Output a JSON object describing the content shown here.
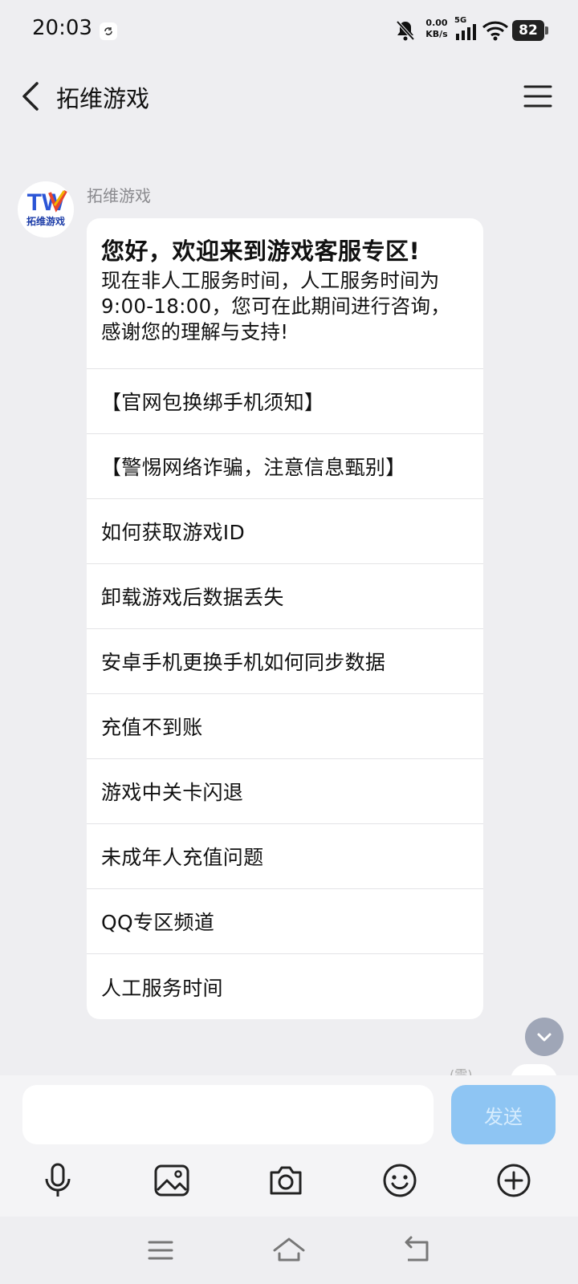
{
  "status_bar": {
    "time": "20:03",
    "net_speed_value": "0.00",
    "net_speed_unit": "KB/s",
    "signal_label": "5G",
    "battery": "82"
  },
  "header": {
    "title": "拓维游戏"
  },
  "chat": {
    "sender_name": "拓维游戏",
    "avatar_logo_text": "TW",
    "avatar_sub_text": "拓维游戏",
    "message_title": "您好，欢迎来到游戏客服专区!",
    "message_body": "现在非人工服务时间，人工服务时间为9:00-18:00，您可在此期间进行咨询，感谢您的理解与支持!",
    "menu_items": [
      "【官网包换绑手机须知】",
      "【警惕网络诈骗，注意信息甄别】",
      "如何获取游戏ID",
      "卸载游戏后数据丢失",
      "安卓手机更换手机如何同步数据",
      "充值不到账",
      "游戏中关卡闪退",
      "未成年人充值问题",
      "QQ专区频道",
      "人工服务时间"
    ],
    "partial_text": "(需)"
  },
  "input": {
    "placeholder": "",
    "send_label": "发送"
  },
  "colors": {
    "background": "#eeeef1",
    "bubble": "#ffffff",
    "send_button": "#8ec5f3",
    "scroll_button": "#9fa6b7"
  }
}
